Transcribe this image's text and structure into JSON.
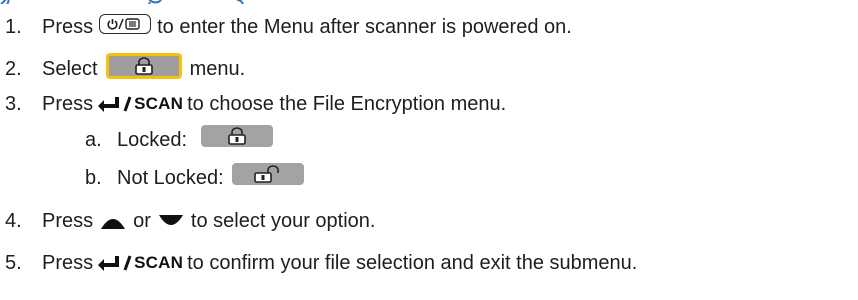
{
  "steps": [
    {
      "num": "1.",
      "pre": "Press",
      "post": "to enter the Menu after scanner is powered on."
    },
    {
      "num": "2.",
      "pre": "Select",
      "post": "menu."
    },
    {
      "num": "3.",
      "pre": "Press",
      "post": "to choose the File Encryption menu."
    },
    {
      "num": "a.",
      "pre": "Locked:"
    },
    {
      "num": "b.",
      "pre": "Not Locked:"
    },
    {
      "num": "4.",
      "pre": "Press",
      "mid": "or",
      "post": "to select your option."
    },
    {
      "num": "5.",
      "pre": "Press",
      "post": "to confirm your file selection and exit the submenu."
    }
  ],
  "scan_label": "SCAN",
  "colors": {
    "heading": "#2f74b5",
    "menu_border": "#f4c20d",
    "key_gray": "#9e9e9e"
  }
}
